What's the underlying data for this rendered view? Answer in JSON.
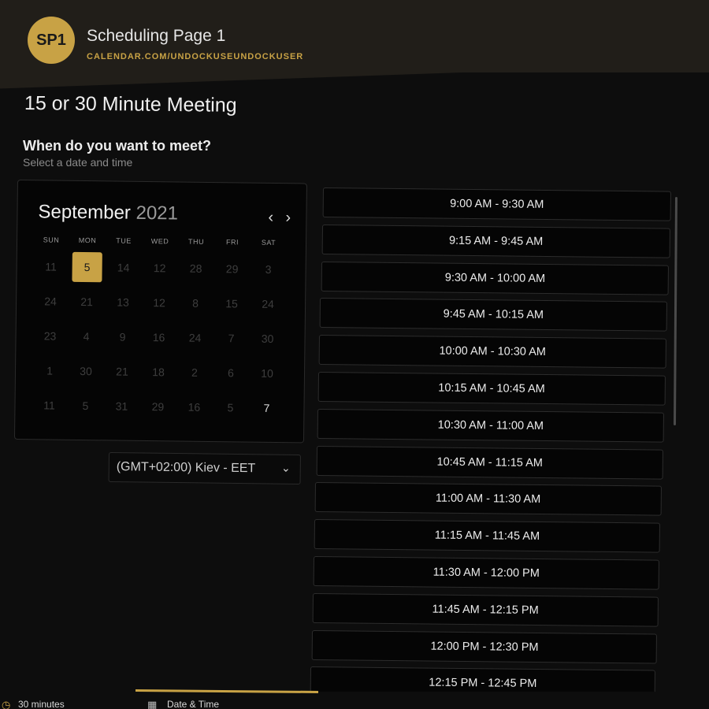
{
  "header": {
    "avatar_initials": "SP1",
    "title": "Scheduling Page 1",
    "url": "CALENDAR.COM/UNDOCKUSEUNDOCKUSER"
  },
  "page": {
    "title": "15 or 30 Minute Meeting",
    "question": "When do you want to meet?",
    "hint": "Select a date and time"
  },
  "calendar": {
    "month": "September",
    "year": "2021",
    "prev_icon": "chevron-left-icon",
    "next_icon": "chevron-right-icon",
    "weekdays": [
      "SUN",
      "MON",
      "TUE",
      "WED",
      "THU",
      "FRI",
      "SAT"
    ],
    "weeks": [
      [
        "11",
        "5",
        "14",
        "12",
        "28",
        "29",
        "3"
      ],
      [
        "24",
        "21",
        "13",
        "12",
        "8",
        "15",
        "24"
      ],
      [
        "23",
        "4",
        "9",
        "16",
        "24",
        "7",
        "30"
      ],
      [
        "1",
        "30",
        "21",
        "18",
        "2",
        "6",
        "10"
      ],
      [
        "11",
        "5",
        "31",
        "29",
        "16",
        "5",
        "7"
      ]
    ],
    "selected_day": "5",
    "accent_color": "#c8a245"
  },
  "timezone": {
    "label": "(GMT+02:00) Kiev - EET"
  },
  "slots": [
    "9:00 AM - 9:30 AM",
    "9:15 AM - 9:45 AM",
    "9:30 AM - 10:00 AM",
    "9:45 AM - 10:15 AM",
    "10:00 AM - 10:30 AM",
    "10:15 AM - 10:45 AM",
    "10:30 AM - 11:00 AM",
    "10:45 AM - 11:15 AM",
    "11:00 AM - 11:30 AM",
    "11:15 AM - 11:45 AM",
    "11:30 AM - 12:00 PM",
    "11:45 AM - 12:15 PM",
    "12:00 PM - 12:30 PM",
    "12:15 PM - 12:45 PM"
  ],
  "footer": {
    "duration": "30 minutes",
    "step": "Date & Time",
    "duration_icon": "clock-icon",
    "step_icon": "calendar-icon"
  }
}
